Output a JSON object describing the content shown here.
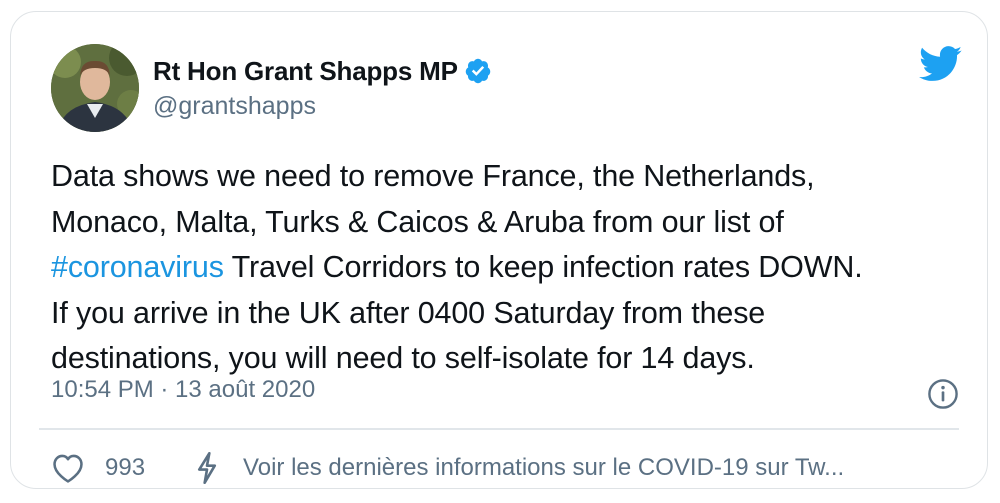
{
  "author": {
    "display_name": "Rt Hon Grant Shapps MP",
    "handle": "@grantshapps",
    "verified": true
  },
  "tweet": {
    "lines": [
      [
        "Data shows we need to remove France, the Netherlands,"
      ],
      [
        "Monaco, Malta, Turks & Caicos & Aruba from our list of"
      ],
      [
        "#coronavirus",
        " Travel Corridors to keep infection rates DOWN."
      ],
      [
        "If you arrive in the UK after 0400 Saturday from these"
      ],
      [
        "destinations, you will need to self-isolate for 14 days."
      ]
    ]
  },
  "meta": {
    "timestamp": "10:54 PM · 13 août 2020"
  },
  "actions": {
    "like_count": "993",
    "covid_link": "Voir les dernières informations sur le COVID-19 sur Tw..."
  },
  "colors": {
    "brand_blue": "#1da1f2",
    "hashtag": "#1b95e0",
    "text_primary": "#0f1419",
    "text_secondary": "#5b7083"
  },
  "icons": {
    "verified": "verified-badge-icon",
    "brand": "twitter-bird-icon",
    "info": "info-icon",
    "like": "heart-icon",
    "covid": "lightning-bolt-icon"
  }
}
